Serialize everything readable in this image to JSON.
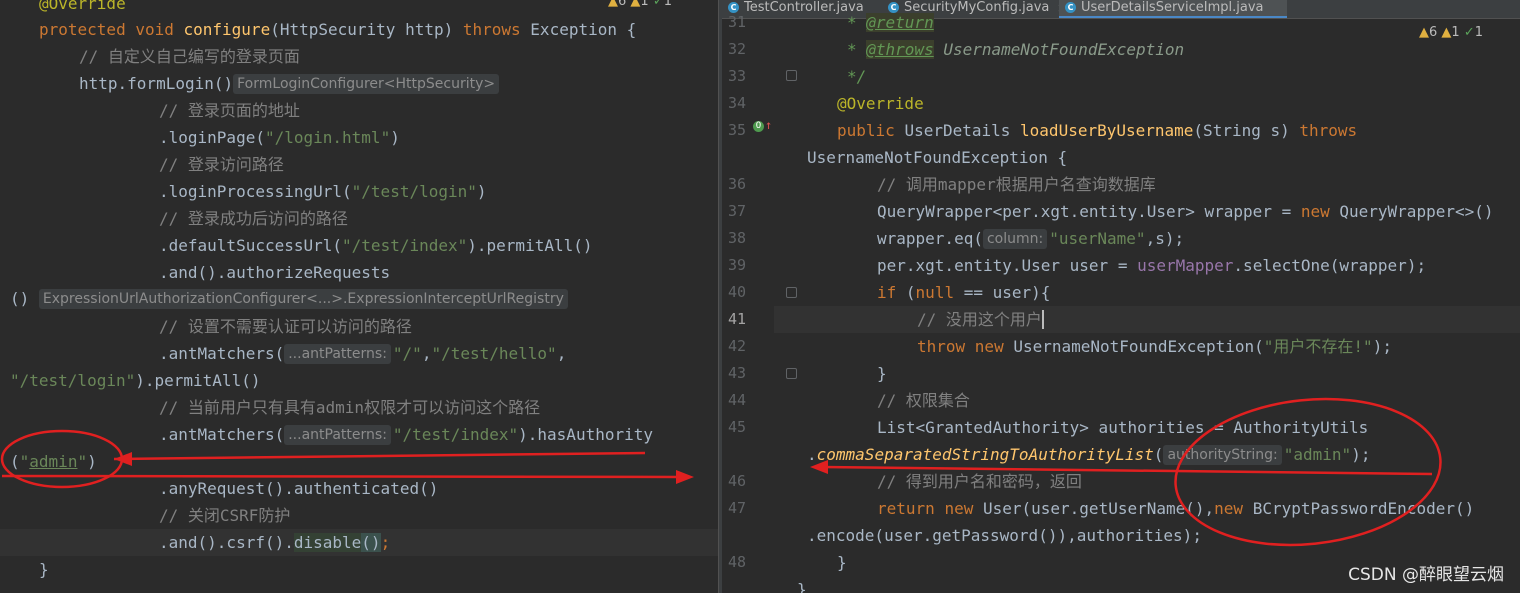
{
  "left": {
    "inspection": {
      "warnings": "6",
      "weak": "1",
      "typos": "1"
    },
    "lines": {
      "l0": "@Override",
      "l1_kw": "protected void ",
      "l1_name": "configure",
      "l1_params": "(HttpSecurity http) ",
      "l1_throws": "throws ",
      "l1_ex": "Exception {",
      "l2": "// 自定义自己编写的登录页面",
      "l3_code": "http.formLogin()",
      "l3_hint": "FormLoginConfigurer<HttpSecurity>",
      "l4": "// 登录页面的地址",
      "l5_a": ".loginPage(",
      "l5_s": "\"/login.html\"",
      "l5_b": ")",
      "l6": "// 登录访问路径",
      "l7_a": ".loginProcessingUrl(",
      "l7_s": "\"/test/login\"",
      "l7_b": ")",
      "l8": "// 登录成功后访问的路径",
      "l9_a": ".defaultSuccessUrl(",
      "l9_s": "\"/test/index\"",
      "l9_b": ").permitAll()",
      "l10": ".and().authorizeRequests",
      "l11_a": "()",
      "l11_hint": "ExpressionUrlAuthorizationConfigurer<...>.ExpressionInterceptUrlRegistry",
      "l12": "// 设置不需要认证可以访问的路径",
      "l13_a": ".antMatchers(",
      "l13_hint": "...antPatterns:",
      "l13_s1": "\"/\"",
      "l13_c1": ",",
      "l13_s2": "\"/test/hello\"",
      "l13_c2": ",",
      "l14_s": "\"/test/login\"",
      "l14_b": ").permitAll()",
      "l15": "// 当前用户只有具有admin权限才可以访问这个路径",
      "l16_a": ".antMatchers(",
      "l16_hint": "...antPatterns:",
      "l16_s": "\"/test/index\"",
      "l16_b": ").hasAuthority",
      "l17_a": "(",
      "l17_q1": "\"",
      "l17_s": "admin",
      "l17_q2": "\"",
      "l17_b": ")",
      "l18": ".anyRequest().authenticated()",
      "l19": "// 关闭CSRF防护",
      "l20_a": ".and().csrf().",
      "l20_b": "disable",
      "l20_c": "()",
      "l20_d": ";",
      "l21": "}"
    }
  },
  "right": {
    "tabs": [
      {
        "label": "TestController.java"
      },
      {
        "label": "SecurityMyConfig.java"
      },
      {
        "label": "UserDetailsServiceImpl.java"
      }
    ],
    "inspection": {
      "warnings": "6",
      "weak": "1",
      "typos": "1"
    },
    "line_numbers": [
      "31",
      "32",
      "33",
      "34",
      "35",
      "36",
      "37",
      "38",
      "39",
      "40",
      "41",
      "42",
      "43",
      "44",
      "45",
      "46",
      "47",
      "48"
    ],
    "lines": {
      "r0_star": "* ",
      "r0_tag": "@return",
      "r1_star": "* ",
      "r1_tag": "@throws",
      "r1_text": " UsernameNotFoundException",
      "r2": "*/",
      "r3": "@Override",
      "r4_kw": "public ",
      "r4_type": "UserDetails ",
      "r4_name": "loadUserByUsername",
      "r4_params": "(String s) ",
      "r4_throws": "throws",
      "r5": "UsernameNotFoundException {",
      "r6": "// 调用mapper根据用户名查询数据库",
      "r7_a": "QueryWrapper<per.xgt.entity.User> wrapper = ",
      "r7_new": "new ",
      "r7_b": "QueryWrapper<>()",
      "r8_a": "wrapper.eq(",
      "r8_hint": "column:",
      "r8_s": "\"userName\"",
      "r8_b": ",s);",
      "r9_a": "per.xgt.entity.User user = ",
      "r9_f": "userMapper",
      "r9_b": ".selectOne(wrapper);",
      "r10_if": "if ",
      "r10_a": "(",
      "r10_null": "null ",
      "r10_b": "== user){",
      "r11": "// 没用这个用户",
      "r12_throw": "throw ",
      "r12_new": "new ",
      "r12_a": "UsernameNotFoundException(",
      "r12_s": "\"用户不存在!\"",
      "r12_b": ");",
      "r13": "}",
      "r14": "// 权限集合",
      "r15": "List<GrantedAuthority> authorities = AuthorityUtils",
      "r16_a": ".",
      "r16_m": "commaSeparatedStringToAuthorityList",
      "r16_p": "(",
      "r16_hint": "authorityString:",
      "r16_s": "\"admin\"",
      "r16_b": ");",
      "r17": "// 得到用户名和密码，返回",
      "r18_ret": "return ",
      "r18_new": "new ",
      "r18_a": "User(user.getUserName(),",
      "r18_new2": "new ",
      "r18_b": "BCryptPasswordEncoder()",
      "r19": ".encode(user.getPassword()),authorities);",
      "r20": "}",
      "r21": "}"
    }
  },
  "watermark": "CSDN @醉眼望云烟",
  "annotation_color": "#e02020"
}
